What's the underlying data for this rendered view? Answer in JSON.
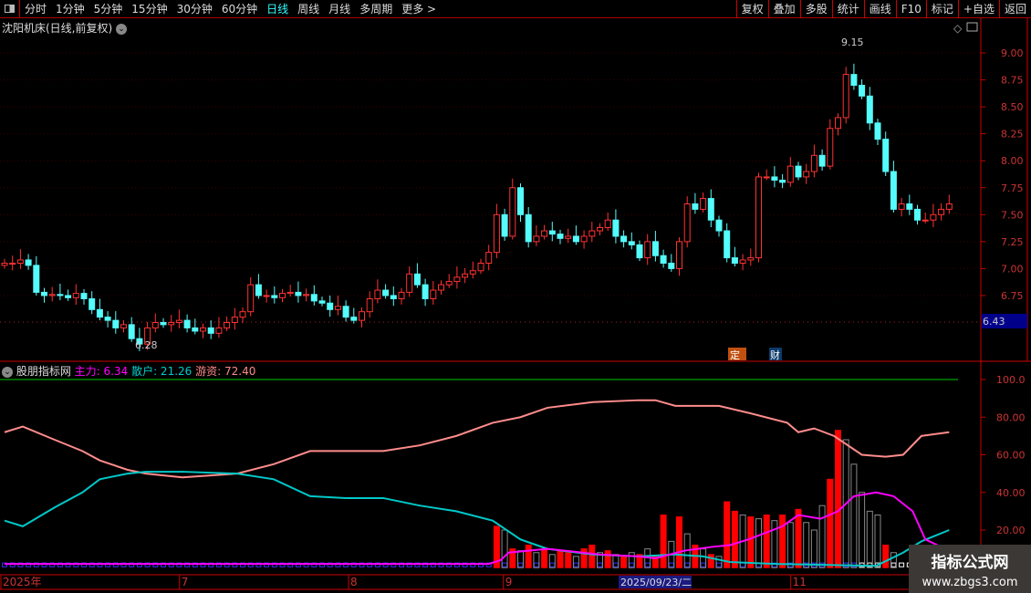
{
  "toolbar": {
    "periods": [
      "分时",
      "1分钟",
      "5分钟",
      "15分钟",
      "30分钟",
      "60分钟",
      "日线",
      "周线",
      "月线",
      "多周期",
      "更多 >"
    ],
    "active": "日线",
    "right": [
      "复权",
      "叠加",
      "多股",
      "统计",
      "画线",
      "F10",
      "标记",
      "+自选",
      "返回"
    ]
  },
  "stock_title": "沈阳机床(日线,前复权)",
  "price_axis": [
    "9.00",
    "8.75",
    "8.50",
    "8.25",
    "8.00",
    "7.75",
    "7.50",
    "7.25",
    "7.00",
    "6.75"
  ],
  "current_price_label": "6.43",
  "high_label": "9.15",
  "low_label": "6.28",
  "markers": [
    "定",
    "财"
  ],
  "indicator": {
    "name": "股朋指标网",
    "main_label": "主力: 6.34",
    "retail_label": "散户: 21.26",
    "hot_label": "游资: 72.40",
    "axis": [
      "100.0",
      "80.00",
      "60.00",
      "40.00",
      "20.00"
    ]
  },
  "colors": {
    "up": "#ff3232",
    "down": "#54fcfc",
    "main": "#ff00ff",
    "retail": "#00c8c8",
    "hot": "#ff8c8c"
  },
  "x_axis": {
    "labels": [
      {
        "day": 0,
        "text": "2025年"
      },
      {
        "day": 22.5,
        "text": "7"
      },
      {
        "day": 43.8,
        "text": "8"
      },
      {
        "day": 63.3,
        "text": "9"
      },
      {
        "day": 99.5,
        "text": "11"
      }
    ],
    "cursor_label": "2025/09/23/二"
  },
  "watermark": {
    "line1": "指标公式网",
    "line2": "www.zbgs3.com"
  },
  "chart_data": {
    "type": "candlestick",
    "closes": [
      7.05,
      7.05,
      7.08,
      7.03,
      6.78,
      6.75,
      6.76,
      6.75,
      6.73,
      6.77,
      6.72,
      6.62,
      6.55,
      6.52,
      6.45,
      6.48,
      6.35,
      6.3,
      6.45,
      6.5,
      6.48,
      6.5,
      6.52,
      6.45,
      6.42,
      6.45,
      6.4,
      6.45,
      6.5,
      6.55,
      6.6,
      6.85,
      6.75,
      6.75,
      6.73,
      6.77,
      6.78,
      6.75,
      6.76,
      6.7,
      6.68,
      6.62,
      6.65,
      6.55,
      6.52,
      6.6,
      6.72,
      6.8,
      6.75,
      6.72,
      6.78,
      6.95,
      6.85,
      6.72,
      6.8,
      6.85,
      6.88,
      6.92,
      6.95,
      6.98,
      7.05,
      7.15,
      7.5,
      7.3,
      7.75,
      7.5,
      7.25,
      7.3,
      7.35,
      7.32,
      7.28,
      7.3,
      7.25,
      7.3,
      7.35,
      7.38,
      7.45,
      7.3,
      7.25,
      7.22,
      7.1,
      7.25,
      7.12,
      7.05,
      7.0,
      7.25,
      7.6,
      7.55,
      7.65,
      7.45,
      7.35,
      7.1,
      7.05,
      7.08,
      7.1,
      7.85,
      7.85,
      7.82,
      7.8,
      7.95,
      7.85,
      7.9,
      8.05,
      7.95,
      8.3,
      8.4,
      8.8,
      8.7,
      8.6,
      8.35,
      8.2,
      7.9,
      7.55,
      7.6,
      7.55,
      7.45,
      7.45,
      7.5,
      7.55,
      7.6
    ],
    "hot": [
      [
        0,
        72
      ],
      [
        2.3,
        75
      ],
      [
        6.3,
        68
      ],
      [
        9.8,
        62
      ],
      [
        12,
        57
      ],
      [
        15.5,
        52
      ],
      [
        17.8,
        50
      ],
      [
        22.4,
        48
      ],
      [
        29.3,
        50
      ],
      [
        33.9,
        55
      ],
      [
        38.5,
        62
      ],
      [
        43,
        62
      ],
      [
        47.7,
        62
      ],
      [
        52.3,
        65
      ],
      [
        56.9,
        70
      ],
      [
        61.5,
        77
      ],
      [
        65,
        80
      ],
      [
        68.4,
        85
      ],
      [
        74.1,
        88
      ],
      [
        79.9,
        89
      ],
      [
        82,
        89
      ],
      [
        84.5,
        86
      ],
      [
        90,
        86
      ],
      [
        94,
        82
      ],
      [
        98.6,
        77
      ],
      [
        100,
        72
      ],
      [
        102,
        74
      ],
      [
        104.5,
        70
      ],
      [
        108,
        60
      ],
      [
        111,
        59
      ],
      [
        113.2,
        60
      ],
      [
        115.5,
        70
      ],
      [
        119,
        72
      ]
    ],
    "retail": [
      [
        0,
        25
      ],
      [
        2.3,
        22
      ],
      [
        6.3,
        32
      ],
      [
        9.8,
        40
      ],
      [
        12,
        47
      ],
      [
        15.5,
        50
      ],
      [
        17.8,
        51
      ],
      [
        22.4,
        51
      ],
      [
        29.3,
        50
      ],
      [
        33.9,
        47
      ],
      [
        38.5,
        38
      ],
      [
        43,
        37
      ],
      [
        47.7,
        37
      ],
      [
        52.3,
        33
      ],
      [
        56.9,
        30
      ],
      [
        61.5,
        25
      ],
      [
        65,
        15
      ],
      [
        68.4,
        10
      ],
      [
        74.1,
        7
      ],
      [
        79.9,
        6
      ],
      [
        84.5,
        7
      ],
      [
        88,
        6
      ],
      [
        91.4,
        3
      ],
      [
        97.1,
        2
      ],
      [
        109.8,
        1
      ],
      [
        113.2,
        8
      ],
      [
        115.5,
        14
      ],
      [
        119,
        20
      ]
    ],
    "main": [
      [
        0,
        2
      ],
      [
        61,
        2
      ],
      [
        62.5,
        4
      ],
      [
        63.5,
        8
      ],
      [
        68.4,
        10
      ],
      [
        70.7,
        9
      ],
      [
        75,
        7
      ],
      [
        79.9,
        6
      ],
      [
        82,
        5
      ],
      [
        85.6,
        9
      ],
      [
        89,
        11
      ],
      [
        91.4,
        12
      ],
      [
        93.7,
        15
      ],
      [
        98,
        22
      ],
      [
        100,
        28
      ],
      [
        102.8,
        26
      ],
      [
        105,
        30
      ],
      [
        107,
        38
      ],
      [
        109.8,
        40
      ],
      [
        112,
        38
      ],
      [
        114.4,
        30
      ],
      [
        116,
        15
      ],
      [
        118.5,
        10
      ]
    ],
    "hist": [
      [
        62,
        22,
        1
      ],
      [
        63,
        20,
        0
      ],
      [
        64,
        10,
        1
      ],
      [
        65,
        9,
        0
      ],
      [
        66,
        12,
        1
      ],
      [
        67,
        8,
        0
      ],
      [
        68,
        10,
        1
      ],
      [
        69,
        7,
        0
      ],
      [
        70,
        9,
        1
      ],
      [
        71,
        8,
        1
      ],
      [
        72,
        6,
        0
      ],
      [
        73,
        10,
        1
      ],
      [
        74,
        12,
        1
      ],
      [
        75,
        8,
        0
      ],
      [
        76,
        9,
        1
      ],
      [
        77,
        7,
        0
      ],
      [
        78,
        6,
        1
      ],
      [
        79,
        8,
        0
      ],
      [
        80,
        7,
        1
      ],
      [
        81,
        10,
        0
      ],
      [
        82,
        6,
        1
      ],
      [
        83,
        28,
        1
      ],
      [
        84,
        14,
        0
      ],
      [
        85,
        27,
        1
      ],
      [
        86,
        18,
        0
      ],
      [
        87,
        12,
        1
      ],
      [
        88,
        10,
        0
      ],
      [
        89,
        7,
        1
      ],
      [
        90,
        6,
        0
      ],
      [
        91,
        35,
        1
      ],
      [
        92,
        30,
        1
      ],
      [
        93,
        28,
        0
      ],
      [
        94,
        27,
        1
      ],
      [
        95,
        26,
        0
      ],
      [
        96,
        28,
        1
      ],
      [
        97,
        25,
        0
      ],
      [
        98,
        28,
        1
      ],
      [
        99,
        24,
        0
      ],
      [
        100,
        31,
        1
      ],
      [
        101,
        24,
        0
      ],
      [
        102,
        20,
        0
      ],
      [
        103,
        33,
        0
      ],
      [
        104,
        47,
        1
      ],
      [
        105,
        73,
        1
      ],
      [
        106,
        68,
        0
      ],
      [
        107,
        55,
        0
      ],
      [
        108,
        40,
        0
      ],
      [
        109,
        30,
        0
      ],
      [
        110,
        28,
        0
      ],
      [
        111,
        12,
        1
      ],
      [
        112,
        8,
        0
      ]
    ]
  }
}
